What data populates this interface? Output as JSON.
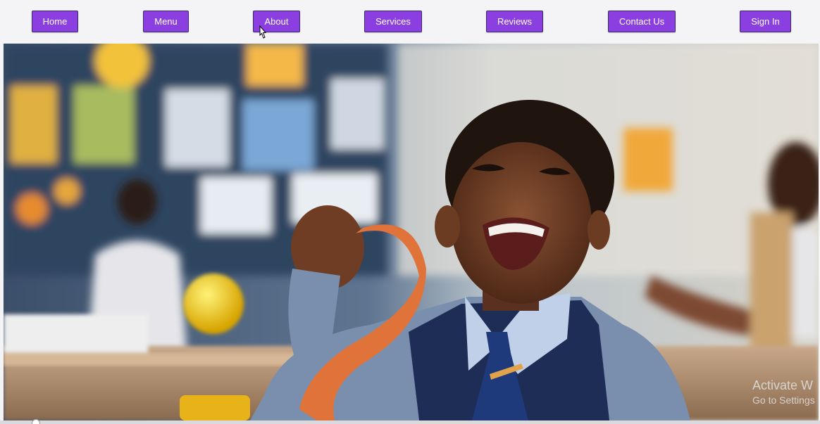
{
  "nav": {
    "items": [
      {
        "label": "Home"
      },
      {
        "label": "Menu"
      },
      {
        "label": "About"
      },
      {
        "label": "Services"
      },
      {
        "label": "Reviews"
      },
      {
        "label": "Contact Us"
      },
      {
        "label": "Sign In"
      }
    ],
    "button_color": "#8c3fe0"
  },
  "hero": {
    "image_subject": "smiling schoolboy holding an orange ribbon in a classroom"
  },
  "os_watermark": {
    "line1": "Activate W",
    "line2": "Go to Settings"
  }
}
